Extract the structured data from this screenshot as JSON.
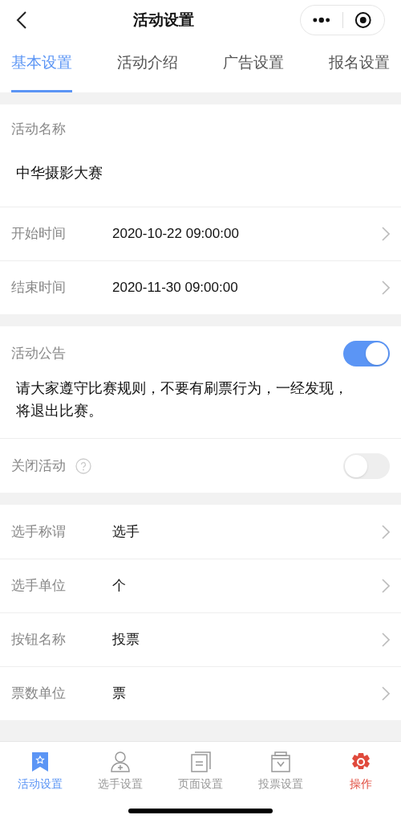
{
  "header": {
    "title": "活动设置"
  },
  "tabs": [
    {
      "label": "基本设置",
      "selected": true
    },
    {
      "label": "活动介绍",
      "selected": false
    },
    {
      "label": "广告设置",
      "selected": false
    },
    {
      "label": "报名设置",
      "selected": false
    }
  ],
  "sections": [
    {
      "rows": [
        {
          "kind": "field",
          "label": "活动名称",
          "value": "中华摄影大赛"
        },
        {
          "kind": "link",
          "label": "开始时间",
          "value": "2020-10-22 09:00:00"
        },
        {
          "kind": "link",
          "label": "结束时间",
          "value": "2020-11-30 09:00:00"
        }
      ]
    },
    {
      "rows": [
        {
          "kind": "toggle",
          "label": "活动公告",
          "on": true,
          "text": "请大家遵守比赛规则，不要有刷票行为，一经发现，将退出比赛。"
        },
        {
          "kind": "toggle",
          "label": "关闭活动",
          "on": false,
          "help": true
        }
      ]
    },
    {
      "rows": [
        {
          "kind": "link",
          "label": "选手称谓",
          "value": "选手"
        },
        {
          "kind": "link",
          "label": "选手单位",
          "value": "个"
        },
        {
          "kind": "link",
          "label": "按钮名称",
          "value": "投票"
        },
        {
          "kind": "link",
          "label": "票数单位",
          "value": "票"
        }
      ]
    }
  ],
  "bottom_nav": [
    {
      "label": "活动设置",
      "kind": "tab",
      "selected": true
    },
    {
      "label": "选手设置",
      "kind": "tab",
      "selected": false
    },
    {
      "label": "页面设置",
      "kind": "tab",
      "selected": false
    },
    {
      "label": "投票设置",
      "kind": "tab",
      "selected": false
    },
    {
      "label": "操作",
      "kind": "action"
    }
  ]
}
